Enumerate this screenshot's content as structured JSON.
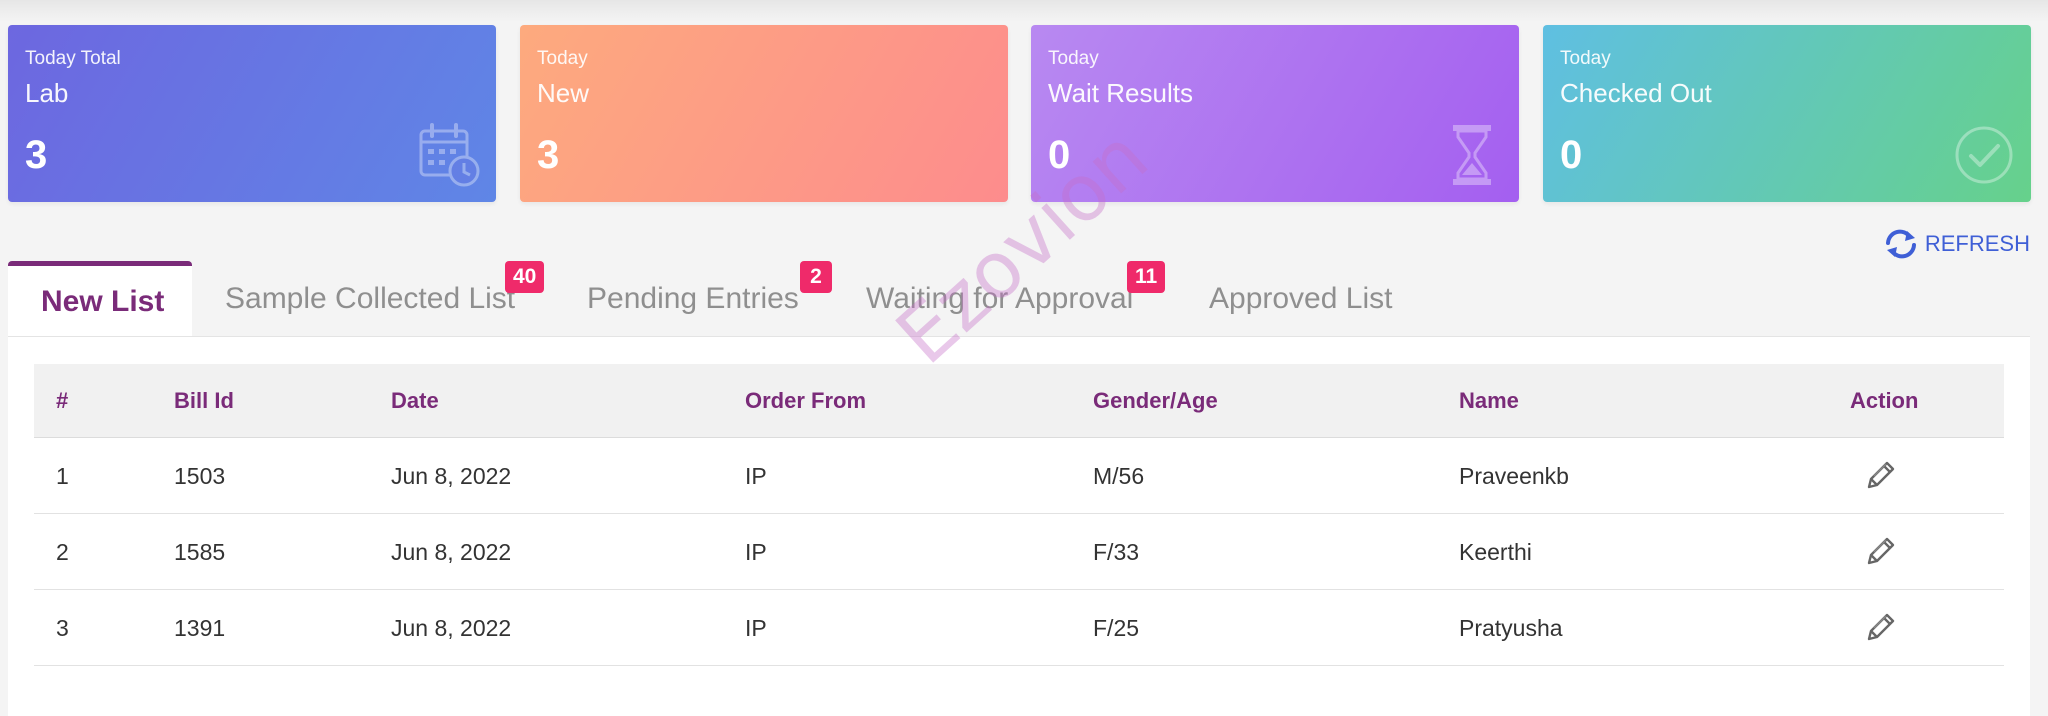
{
  "cards": [
    {
      "subtitle": "Today Total",
      "title": "Lab",
      "count": "3",
      "icon": "calendar-clock-icon"
    },
    {
      "subtitle": "Today",
      "title": "New",
      "count": "3",
      "icon": ""
    },
    {
      "subtitle": "Today",
      "title": "Wait Results",
      "count": "0",
      "icon": "hourglass-icon"
    },
    {
      "subtitle": "Today",
      "title": "Checked Out",
      "count": "0",
      "icon": "check-circle-icon"
    }
  ],
  "refresh": {
    "label": "REFRESH",
    "icon": "refresh-icon",
    "color": "#3f5fd6"
  },
  "tabs": [
    {
      "label": "New List",
      "badge": ""
    },
    {
      "label": "Sample Collected List",
      "badge": "40"
    },
    {
      "label": "Pending Entries",
      "badge": "2"
    },
    {
      "label": "Waiting for Approval",
      "badge": "11"
    },
    {
      "label": "Approved List",
      "badge": ""
    }
  ],
  "table": {
    "headers": [
      "#",
      "Bill Id",
      "Date",
      "Order From",
      "Gender/Age",
      "Name",
      "Action"
    ],
    "rows": [
      {
        "num": "1",
        "bill_id": "1503",
        "date": "Jun 8, 2022",
        "order_from": "IP",
        "gender_age": "M/56",
        "name": "Praveenkb"
      },
      {
        "num": "2",
        "bill_id": "1585",
        "date": "Jun 8, 2022",
        "order_from": "IP",
        "gender_age": "F/33",
        "name": "Keerthi"
      },
      {
        "num": "3",
        "bill_id": "1391",
        "date": "Jun 8, 2022",
        "order_from": "IP",
        "gender_age": "F/25",
        "name": "Pratyusha"
      }
    ],
    "action_icon": "pencil-edit-icon"
  },
  "watermark": "Ezovion",
  "colors": {
    "accent": "#7a2b79",
    "badge": "#ef2a6a",
    "card_lab": "#6d67e0",
    "card_new": "#fd9a86",
    "card_wait": "#ae74f0",
    "card_checked": "#62c8b6"
  }
}
